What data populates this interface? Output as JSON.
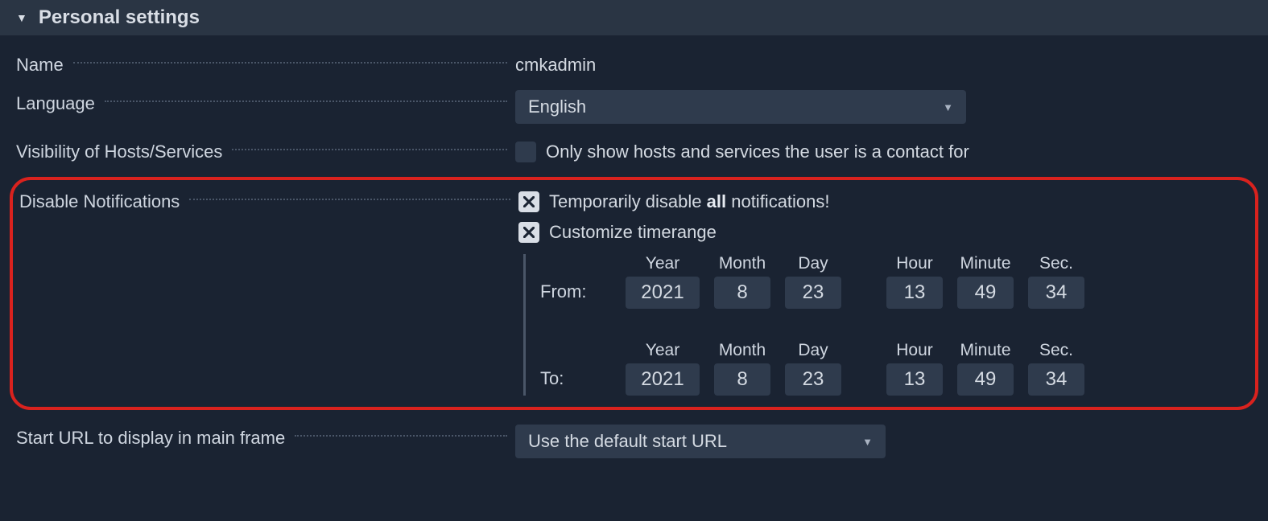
{
  "section_title": "Personal settings",
  "rows": {
    "name": {
      "label": "Name",
      "value": "cmkadmin"
    },
    "language": {
      "label": "Language",
      "value": "English"
    },
    "visibility": {
      "label": "Visibility of Hosts/Services",
      "text": "Only show hosts and services the user is a contact for"
    },
    "disable_notif": {
      "label": "Disable Notifications",
      "opt1_prefix": "Temporarily disable ",
      "opt1_bold": "all",
      "opt1_suffix": " notifications!",
      "opt2": "Customize timerange"
    },
    "start_url": {
      "label": "Start URL to display in main frame",
      "value": "Use the default start URL"
    }
  },
  "dt_headers": {
    "year": "Year",
    "month": "Month",
    "day": "Day",
    "hour": "Hour",
    "minute": "Minute",
    "sec": "Sec."
  },
  "timerange": {
    "from_label": "From:",
    "to_label": "To:",
    "from": {
      "year": "2021",
      "month": "8",
      "day": "23",
      "hour": "13",
      "minute": "49",
      "sec": "34"
    },
    "to": {
      "year": "2021",
      "month": "8",
      "day": "23",
      "hour": "13",
      "minute": "49",
      "sec": "34"
    }
  }
}
